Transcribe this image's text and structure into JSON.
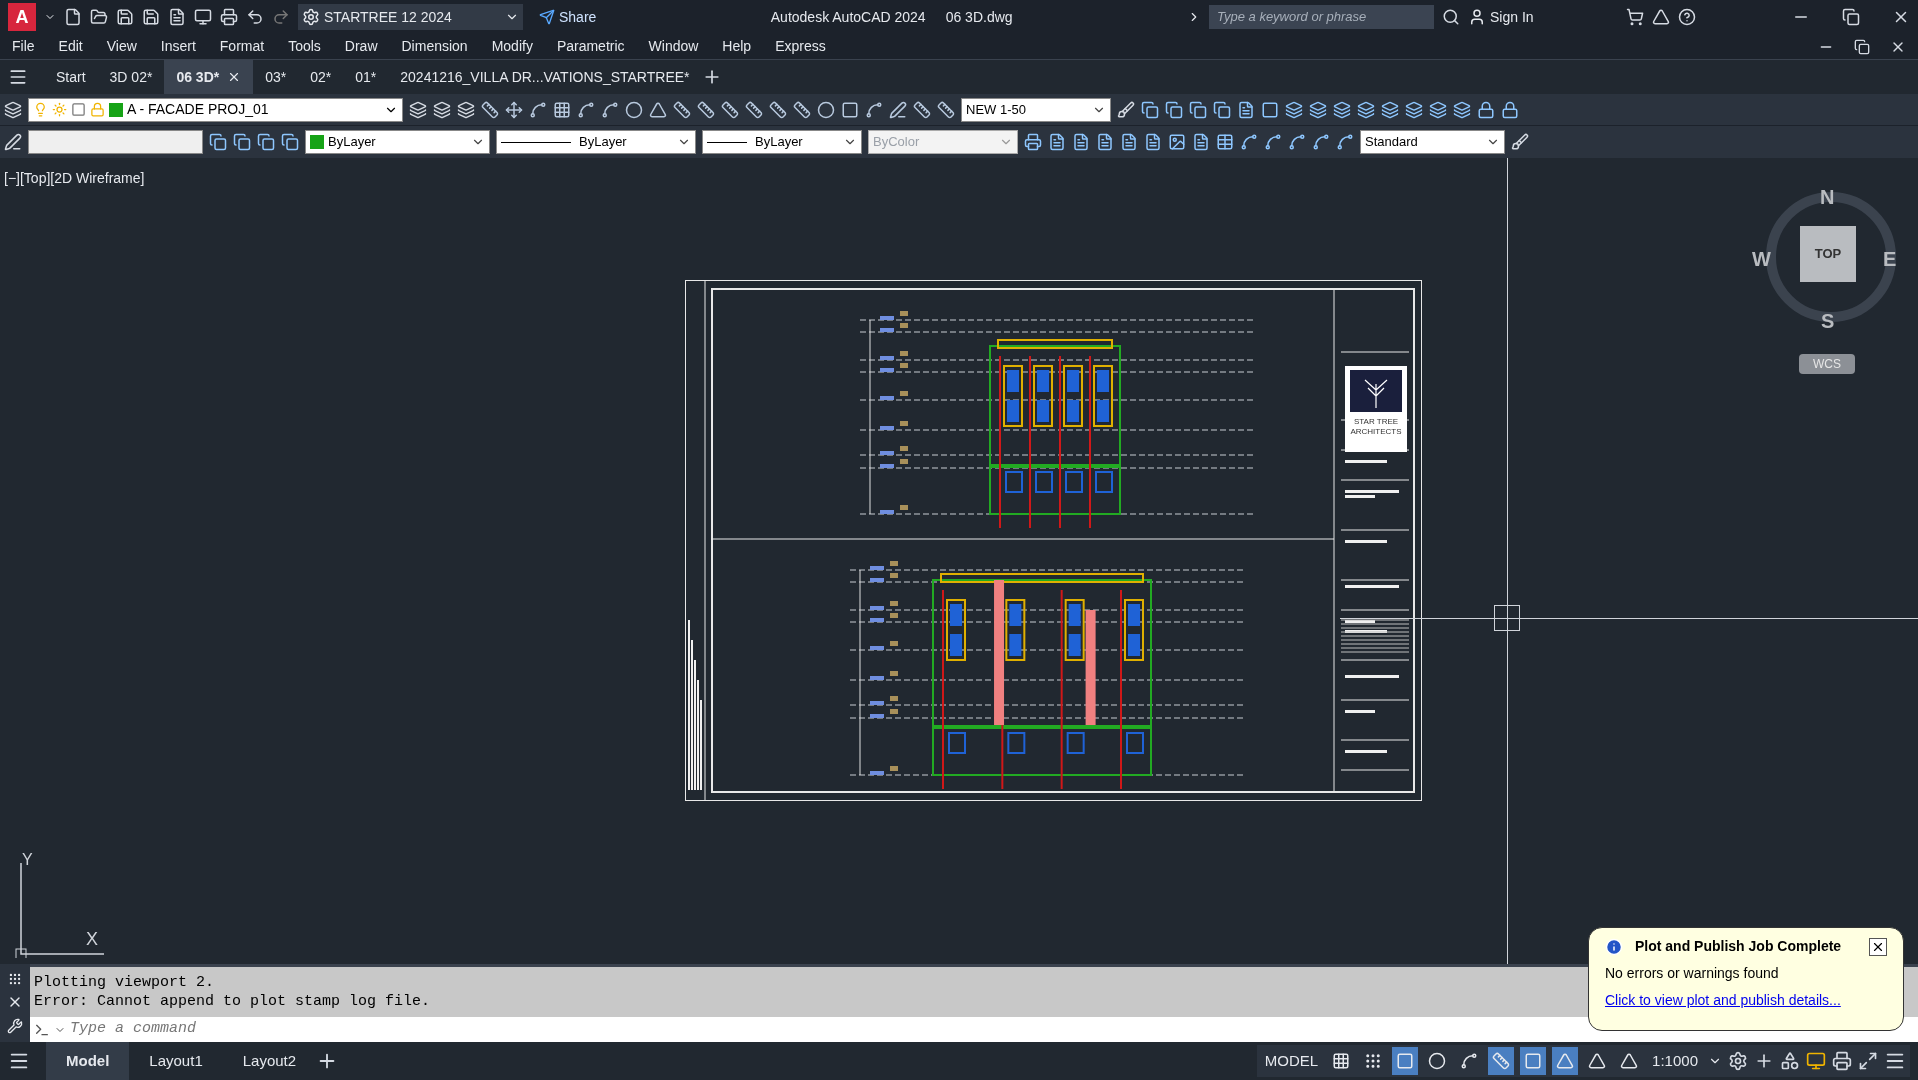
{
  "title_bar": {
    "logo": "A",
    "workspace": "STARTREE 12 2024",
    "share": "Share",
    "app": "Autodesk AutoCAD 2024",
    "file": "06 3D.dwg",
    "search_placeholder": "Type a keyword or phrase",
    "sign_in": "Sign In"
  },
  "menu": [
    "File",
    "Edit",
    "View",
    "Insert",
    "Format",
    "Tools",
    "Draw",
    "Dimension",
    "Modify",
    "Parametric",
    "Window",
    "Help",
    "Express"
  ],
  "tabs": [
    {
      "label": "Start",
      "selected": false,
      "closable": false
    },
    {
      "label": "3D 02*",
      "selected": false,
      "closable": false
    },
    {
      "label": "06 3D*",
      "selected": true,
      "closable": true
    },
    {
      "label": "03*",
      "selected": false,
      "closable": false
    },
    {
      "label": "02*",
      "selected": false,
      "closable": false
    },
    {
      "label": "01*",
      "selected": false,
      "closable": false
    },
    {
      "label": "20241216_VILLA DR...VATIONS_STARTREE*",
      "selected": false,
      "closable": false
    }
  ],
  "layer_toolbar": {
    "layer": "A - FACADE PROJ_01",
    "dim_style": "NEW 1-50"
  },
  "properties_toolbar": {
    "color_setting": "ByLayer",
    "linetype": "ByLayer",
    "lineweight": "ByLayer",
    "plot_style": "ByColor",
    "plot_style_disabled": true,
    "text_style": "Standard"
  },
  "viewport_label": "[−][Top][2D Wireframe]",
  "viewcube": {
    "north": "N",
    "west": "W",
    "east": "E",
    "south": "S",
    "face": "TOP",
    "ucs": "WCS"
  },
  "ucs_icon": {
    "y": "Y",
    "x": "X"
  },
  "drawing": {
    "logo_lines": [
      "STAR TREE",
      "ARCHITECTS"
    ]
  },
  "command_history": [
    "Plotting viewport 2.",
    "Error: Cannot append to plot stamp log file."
  ],
  "command_placeholder": "Type a command",
  "layout_tabs": [
    {
      "label": "Model",
      "selected": true
    },
    {
      "label": "Layout1",
      "selected": false
    },
    {
      "label": "Layout2",
      "selected": false
    }
  ],
  "status_bar": {
    "model": "MODEL",
    "scale": "1:1000",
    "toggles": [
      {
        "on": false
      },
      {
        "on": false
      },
      {
        "on": true
      },
      {
        "on": false
      },
      {
        "on": false
      },
      {
        "on": true
      },
      {
        "on": true
      },
      {
        "on": true
      },
      {
        "on": false
      },
      {
        "on": false
      }
    ]
  },
  "notification": {
    "title": "Plot and Publish Job Complete",
    "message": "No errors or warnings found",
    "link": "Click to view plot and publish details..."
  }
}
